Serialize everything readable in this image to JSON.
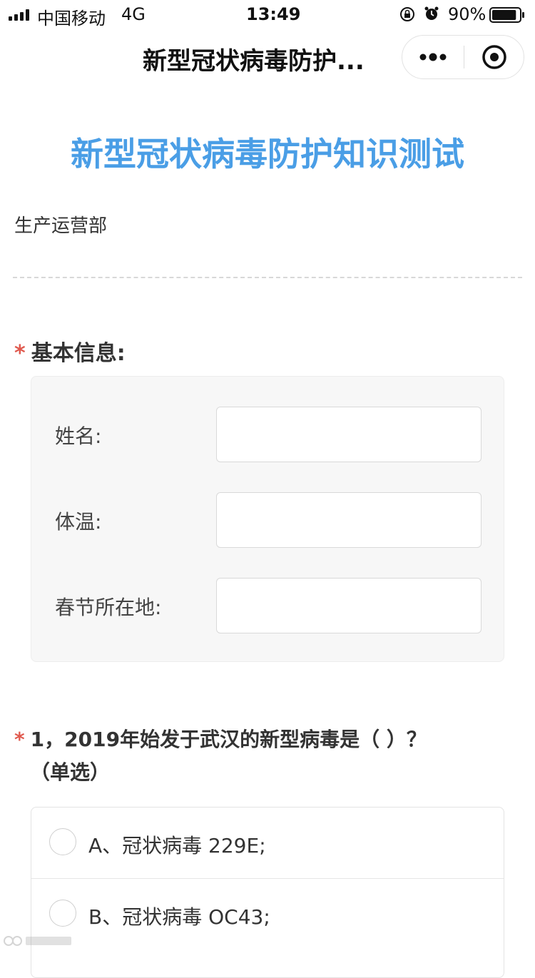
{
  "status_bar": {
    "carrier": "中国移动",
    "network": "4G",
    "time": "13:49",
    "battery": "90%",
    "battery_level": 0.9,
    "icons": [
      "signal-icon",
      "rotation-lock-icon",
      "alarm-icon",
      "battery-icon"
    ]
  },
  "nav": {
    "title": "新型冠状病毒防护...",
    "more_icon": "more-dots-icon",
    "close_icon": "target-close-icon"
  },
  "form": {
    "title": "新型冠状病毒防护知识测试",
    "department": "生产运营部",
    "accent_color": "#4a9ee6",
    "required_color": "#e05a4f",
    "basic_info": {
      "required_mark": "*",
      "title": "基本信息:",
      "fields": [
        {
          "label": "姓名:",
          "value": ""
        },
        {
          "label": "体温:",
          "value": ""
        },
        {
          "label": "春节所在地:",
          "value": ""
        }
      ]
    },
    "question_1": {
      "required_mark": "*",
      "text": "1，2019年始发于武汉的新型病毒是（ ）？",
      "type": "（单选）",
      "options": [
        {
          "label": "A、冠状病毒 229E;"
        },
        {
          "label": "B、冠状病毒 OC43;"
        }
      ]
    }
  }
}
